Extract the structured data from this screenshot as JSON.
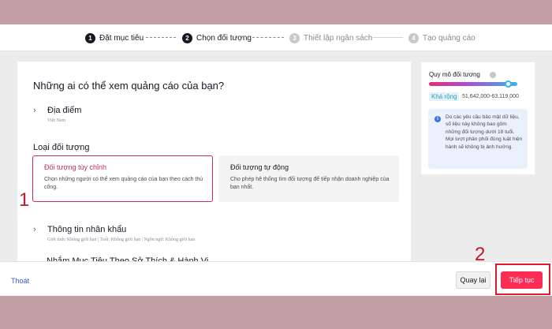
{
  "stepper": {
    "steps": [
      {
        "number": "1",
        "label": "Đặt mục tiêu"
      },
      {
        "number": "2",
        "label": "Chọn đối tượng"
      },
      {
        "number": "3",
        "label": "Thiết lập ngân sách"
      },
      {
        "number": "4",
        "label": "Tạo quảng cáo"
      }
    ]
  },
  "main": {
    "question": "Những ai có thể xem quảng cáo của bạn?",
    "location": {
      "title": "Địa điểm",
      "value": "Việt Nam"
    },
    "audience_type_label": "Loại đối tượng",
    "cards": {
      "custom": {
        "title": "Đối tượng tùy chỉnh",
        "description": "Chọn những người có thể xem quảng cáo của bạn theo cách thủ công.",
        "selected": true
      },
      "auto": {
        "title": "Đối tượng tự động",
        "description": "Cho phép hệ thống tìm đối tượng để tiếp nhận doanh nghiệp của bạn nhất.",
        "selected": false
      }
    },
    "demographics": {
      "title": "Thông tin nhân khẩu",
      "value": "Giới tính: Không giới hạn | Tuổi: Không giới hạn | Ngôn ngữ: Không giới hạn"
    },
    "interests": {
      "title": "Nhắm Mục Tiêu Theo Sở Thích & Hành Vi"
    }
  },
  "sidebar": {
    "title": "Quy mô đối tượng",
    "range_label": "Khá rộng",
    "range_value": "51,642,000-63,119,000",
    "gauge_level": 0.9,
    "notice": "Do các yêu cầu bảo mật dữ liệu, số liệu này không bao gồm những đối tượng dưới 18 tuổi. Mọi lượt phân phối đúng luật hiện hành sẽ không bị ảnh hưởng.",
    "notice_icon": "info-icon"
  },
  "footer": {
    "exit_label": "Thoát",
    "back_label": "Quay lại",
    "next_label": "Tiếp tục"
  },
  "annotations": {
    "marker_1": "1",
    "marker_2": "2"
  },
  "colors": {
    "accent": "#fe2c55",
    "selected_border": "#c72c5c",
    "annotation": "#c0192c"
  }
}
